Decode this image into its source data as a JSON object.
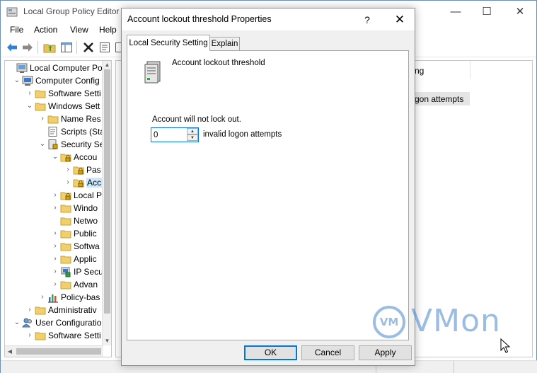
{
  "main_window": {
    "title": "Local Group Policy Editor",
    "controls": {
      "minimize": "—",
      "maximize": "☐",
      "close": "✕"
    }
  },
  "menubar": [
    "File",
    "Action",
    "View",
    "Help"
  ],
  "tree": {
    "items": [
      {
        "label": "Local Computer Polic",
        "icon": "computer-policy-icon",
        "chevron": ""
      },
      {
        "label": "Computer Config",
        "icon": "computer-icon",
        "chevron": "⌄"
      },
      {
        "label": "Software Setti",
        "icon": "folder-icon",
        "chevron": "›"
      },
      {
        "label": "Windows Sett",
        "icon": "folder-icon",
        "chevron": "⌄"
      },
      {
        "label": "Name Res",
        "icon": "folder-icon",
        "chevron": "›"
      },
      {
        "label": "Scripts (Sta",
        "icon": "scripts-icon",
        "chevron": ""
      },
      {
        "label": "Security Se",
        "icon": "security-icon",
        "chevron": "⌄"
      },
      {
        "label": "Accou",
        "icon": "locked-folder-icon",
        "chevron": "⌄"
      },
      {
        "label": "Pas",
        "icon": "locked-folder-icon",
        "chevron": "›"
      },
      {
        "label": "Acc",
        "icon": "locked-folder-icon",
        "chevron": "›"
      },
      {
        "label": "Local P",
        "icon": "locked-folder-icon",
        "chevron": "›"
      },
      {
        "label": "Windo",
        "icon": "folder-icon",
        "chevron": "›"
      },
      {
        "label": "Netwo",
        "icon": "folder-icon",
        "chevron": ""
      },
      {
        "label": "Public",
        "icon": "folder-icon",
        "chevron": "›"
      },
      {
        "label": "Softwa",
        "icon": "folder-icon",
        "chevron": "›"
      },
      {
        "label": "Applic",
        "icon": "folder-icon",
        "chevron": "›"
      },
      {
        "label": "IP Secu",
        "icon": "ip-security-icon",
        "chevron": "›"
      },
      {
        "label": "Advan",
        "icon": "folder-icon",
        "chevron": "›"
      },
      {
        "label": "Policy-bas",
        "icon": "chart-icon",
        "chevron": "›"
      },
      {
        "label": "Administrativ",
        "icon": "folder-icon",
        "chevron": "›"
      },
      {
        "label": "User Configuratio",
        "icon": "users-icon",
        "chevron": "⌄"
      },
      {
        "label": "Software Setti",
        "icon": "folder-icon",
        "chevron": "›"
      }
    ]
  },
  "right_pane": {
    "column_header_fragment": "ng",
    "row_fragment": "gon attempts"
  },
  "dialog": {
    "title": "Account lockout threshold Properties",
    "help": "?",
    "close": "✕",
    "tabs": [
      "Local Security Setting",
      "Explain"
    ],
    "policy_name": "Account lockout threshold",
    "lockout_message": "Account will not lock out.",
    "threshold_value": "0",
    "unit_label": "invalid logon attempts",
    "buttons": {
      "ok": "OK",
      "cancel": "Cancel",
      "apply": "Apply"
    }
  },
  "watermark": {
    "badge": "VM",
    "text": "VMon"
  },
  "colors": {
    "accent": "#0078d7",
    "selection": "#cce8ff",
    "watermark": "#3a7ec8"
  }
}
